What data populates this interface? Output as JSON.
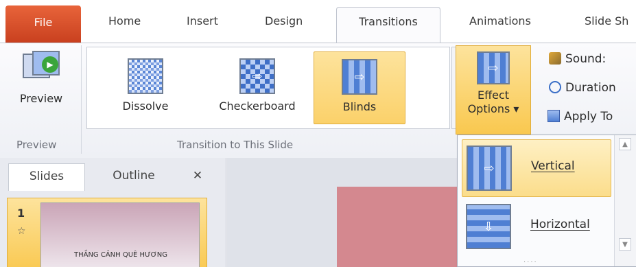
{
  "tabs": {
    "file": "File",
    "home": "Home",
    "insert": "Insert",
    "design": "Design",
    "transitions": "Transitions",
    "animations": "Animations",
    "slide_show": "Slide Sh"
  },
  "ribbon": {
    "preview_button": "Preview",
    "preview_group": "Preview",
    "transition_group": "Transition to This Slide",
    "gallery": [
      {
        "label": "Dissolve",
        "icon": "dissolve-icon"
      },
      {
        "label": "Checkerboard",
        "icon": "checkerboard-icon"
      },
      {
        "label": "Blinds",
        "icon": "blinds-icon",
        "selected": true
      }
    ],
    "effect_options": {
      "line1": "Effect",
      "line2": "Options ▾"
    },
    "sound_label": "Sound:",
    "duration_label": "Duration",
    "apply_to_label": "Apply To"
  },
  "left_panel": {
    "tab_slides": "Slides",
    "tab_outline": "Outline",
    "close_glyph": "✕",
    "slide_number": "1",
    "slide_star": "☆",
    "slide_title": "THẮNG CẢNH QUÊ HƯƠNG"
  },
  "dropdown": {
    "items": [
      {
        "label": "Vertical",
        "selected": true
      },
      {
        "label": "Horizontal",
        "selected": false
      }
    ]
  },
  "colors": {
    "file_tab": "#d9522c",
    "selection": "#fbd16a",
    "transition_blue": "#4f7fd3"
  }
}
